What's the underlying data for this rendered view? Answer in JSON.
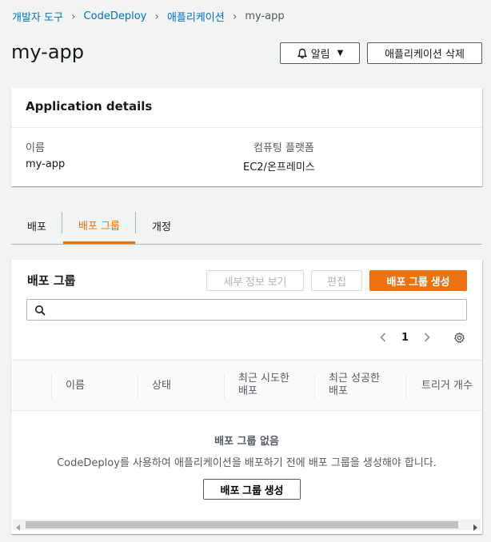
{
  "breadcrumb": {
    "items": [
      "개발자 도구",
      "CodeDeploy",
      "애플리케이션"
    ],
    "current": "my-app"
  },
  "page": {
    "title": "my-app",
    "alarm_label": "알림",
    "delete_label": "애플리케이션 삭제"
  },
  "details": {
    "header": "Application details",
    "name_label": "이름",
    "name_value": "my-app",
    "platform_label": "컴퓨팅 플랫폼",
    "platform_value": "EC2/온프레미스"
  },
  "tabs": [
    {
      "label": "배포",
      "active": false
    },
    {
      "label": "배포 그룹",
      "active": true
    },
    {
      "label": "개정",
      "active": false
    }
  ],
  "groups": {
    "title": "배포 그룹",
    "view_details_label": "세부 정보 보기",
    "edit_label": "편집",
    "create_label": "배포 그룹 생성",
    "search_placeholder": "",
    "page_number": "1",
    "columns": [
      "이름",
      "상태",
      "최근 시도한 배포",
      "최근 성공한 배포",
      "트리거 개수"
    ],
    "column_lines": [
      [
        "이름"
      ],
      [
        "상태"
      ],
      [
        "최근 시도한",
        "배포"
      ],
      [
        "최근 성공한",
        "배포"
      ],
      [
        "트리거 개수"
      ]
    ],
    "empty_title": "배포 그룹 없음",
    "empty_description": "CodeDeploy를 사용하여 애플리케이션을 배포하기 전에 배포 그룹을 생성해야 합니다.",
    "empty_create_label": "배포 그룹 생성"
  },
  "colors": {
    "accent": "#ec7211",
    "link": "#0073bb"
  }
}
